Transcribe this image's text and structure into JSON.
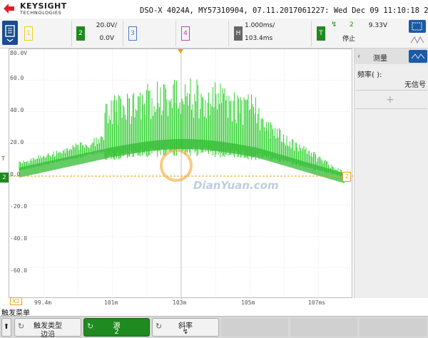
{
  "header": {
    "brand": "KEYSIGHT",
    "brand_sub": "TECHNOLOGIES",
    "info": "DSO-X 4024A, MY57310904, 07.11.2017061227: Wed Dec 09 11:10:18 2020"
  },
  "channels": [
    {
      "num": "1",
      "color": "#e6d21a",
      "scale": "",
      "offset": ""
    },
    {
      "num": "2",
      "color": "#1f8a1f",
      "scale": "20.0V/",
      "offset": "0.0V"
    },
    {
      "num": "3",
      "color": "#4a78c8",
      "scale": "",
      "offset": ""
    },
    {
      "num": "4",
      "color": "#c83cc8",
      "scale": "",
      "offset": ""
    }
  ],
  "timebase": {
    "key": "H",
    "scale": "1.000ms/",
    "delay": "103.4ms"
  },
  "trigger": {
    "key": "T",
    "source": "2",
    "level": "9.33V",
    "status": "停止"
  },
  "waveform": {
    "trace_color": "#22cc22",
    "trigger_level_color": "#e8a020",
    "y_labels": [
      "80.0V",
      "60.0",
      "40.0",
      "20.0",
      "0.0",
      "-20.0",
      "-40.0",
      "-60.0"
    ],
    "x_labels": [
      "99.4m",
      "101m",
      "103m",
      "105m",
      "107ms"
    ],
    "left_marker": "2",
    "right_marker": "2",
    "x_marker": "X2",
    "watermark": "DianYuan.com"
  },
  "measure_panel": {
    "title": "测量",
    "label": "频率(  ):",
    "value": "无信号",
    "add": "+"
  },
  "menu": {
    "title": "触发菜单",
    "keys": [
      {
        "title": "触发类型",
        "value": "边沿"
      },
      {
        "title": "源",
        "value": "2"
      },
      {
        "title": "斜率",
        "value": "↯"
      }
    ]
  }
}
